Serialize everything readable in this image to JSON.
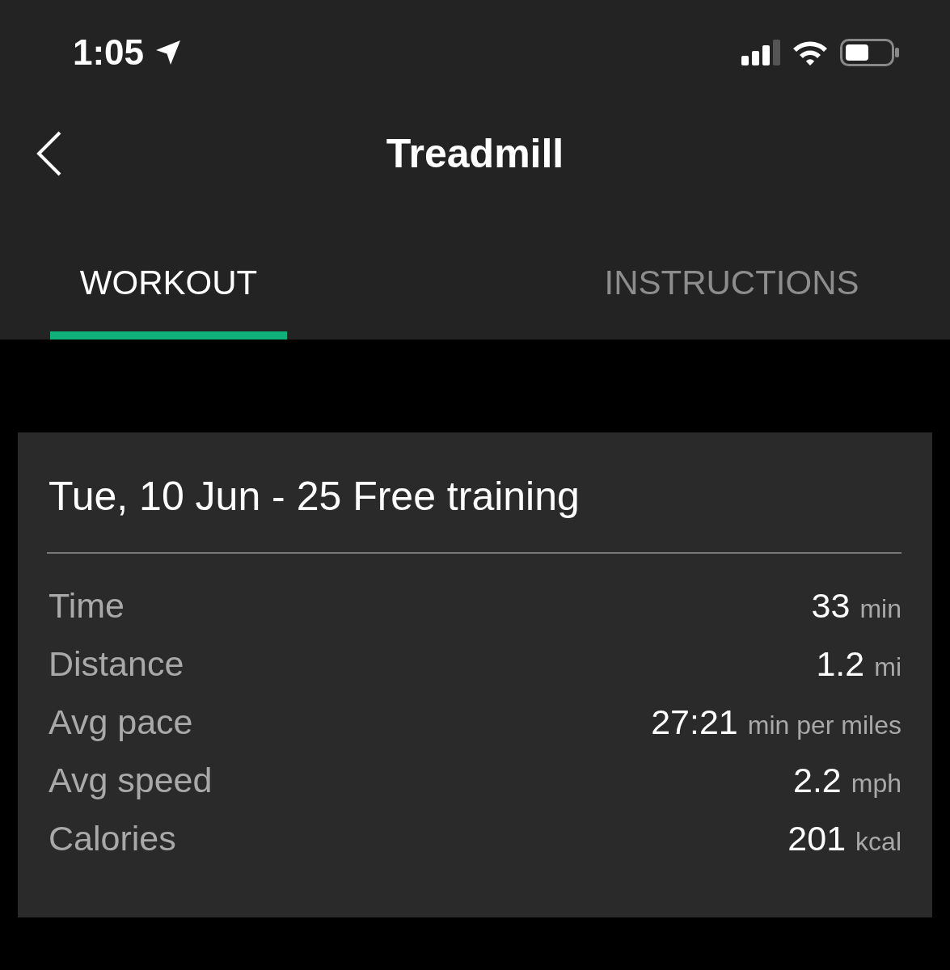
{
  "status_bar": {
    "time": "1:05"
  },
  "nav": {
    "title": "Treadmill"
  },
  "tabs": [
    {
      "label": "WORKOUT",
      "selected": true
    },
    {
      "label": "INSTRUCTIONS",
      "selected": false
    }
  ],
  "workout": {
    "title": "Tue, 10 Jun - 25 Free training",
    "stats": [
      {
        "label": "Time",
        "value": "33",
        "unit": "min"
      },
      {
        "label": "Distance",
        "value": "1.2",
        "unit": "mi"
      },
      {
        "label": "Avg pace",
        "value": "27:21",
        "unit": "min per miles"
      },
      {
        "label": "Avg speed",
        "value": "2.2",
        "unit": "mph"
      },
      {
        "label": "Calories",
        "value": "201",
        "unit": "kcal"
      }
    ]
  }
}
